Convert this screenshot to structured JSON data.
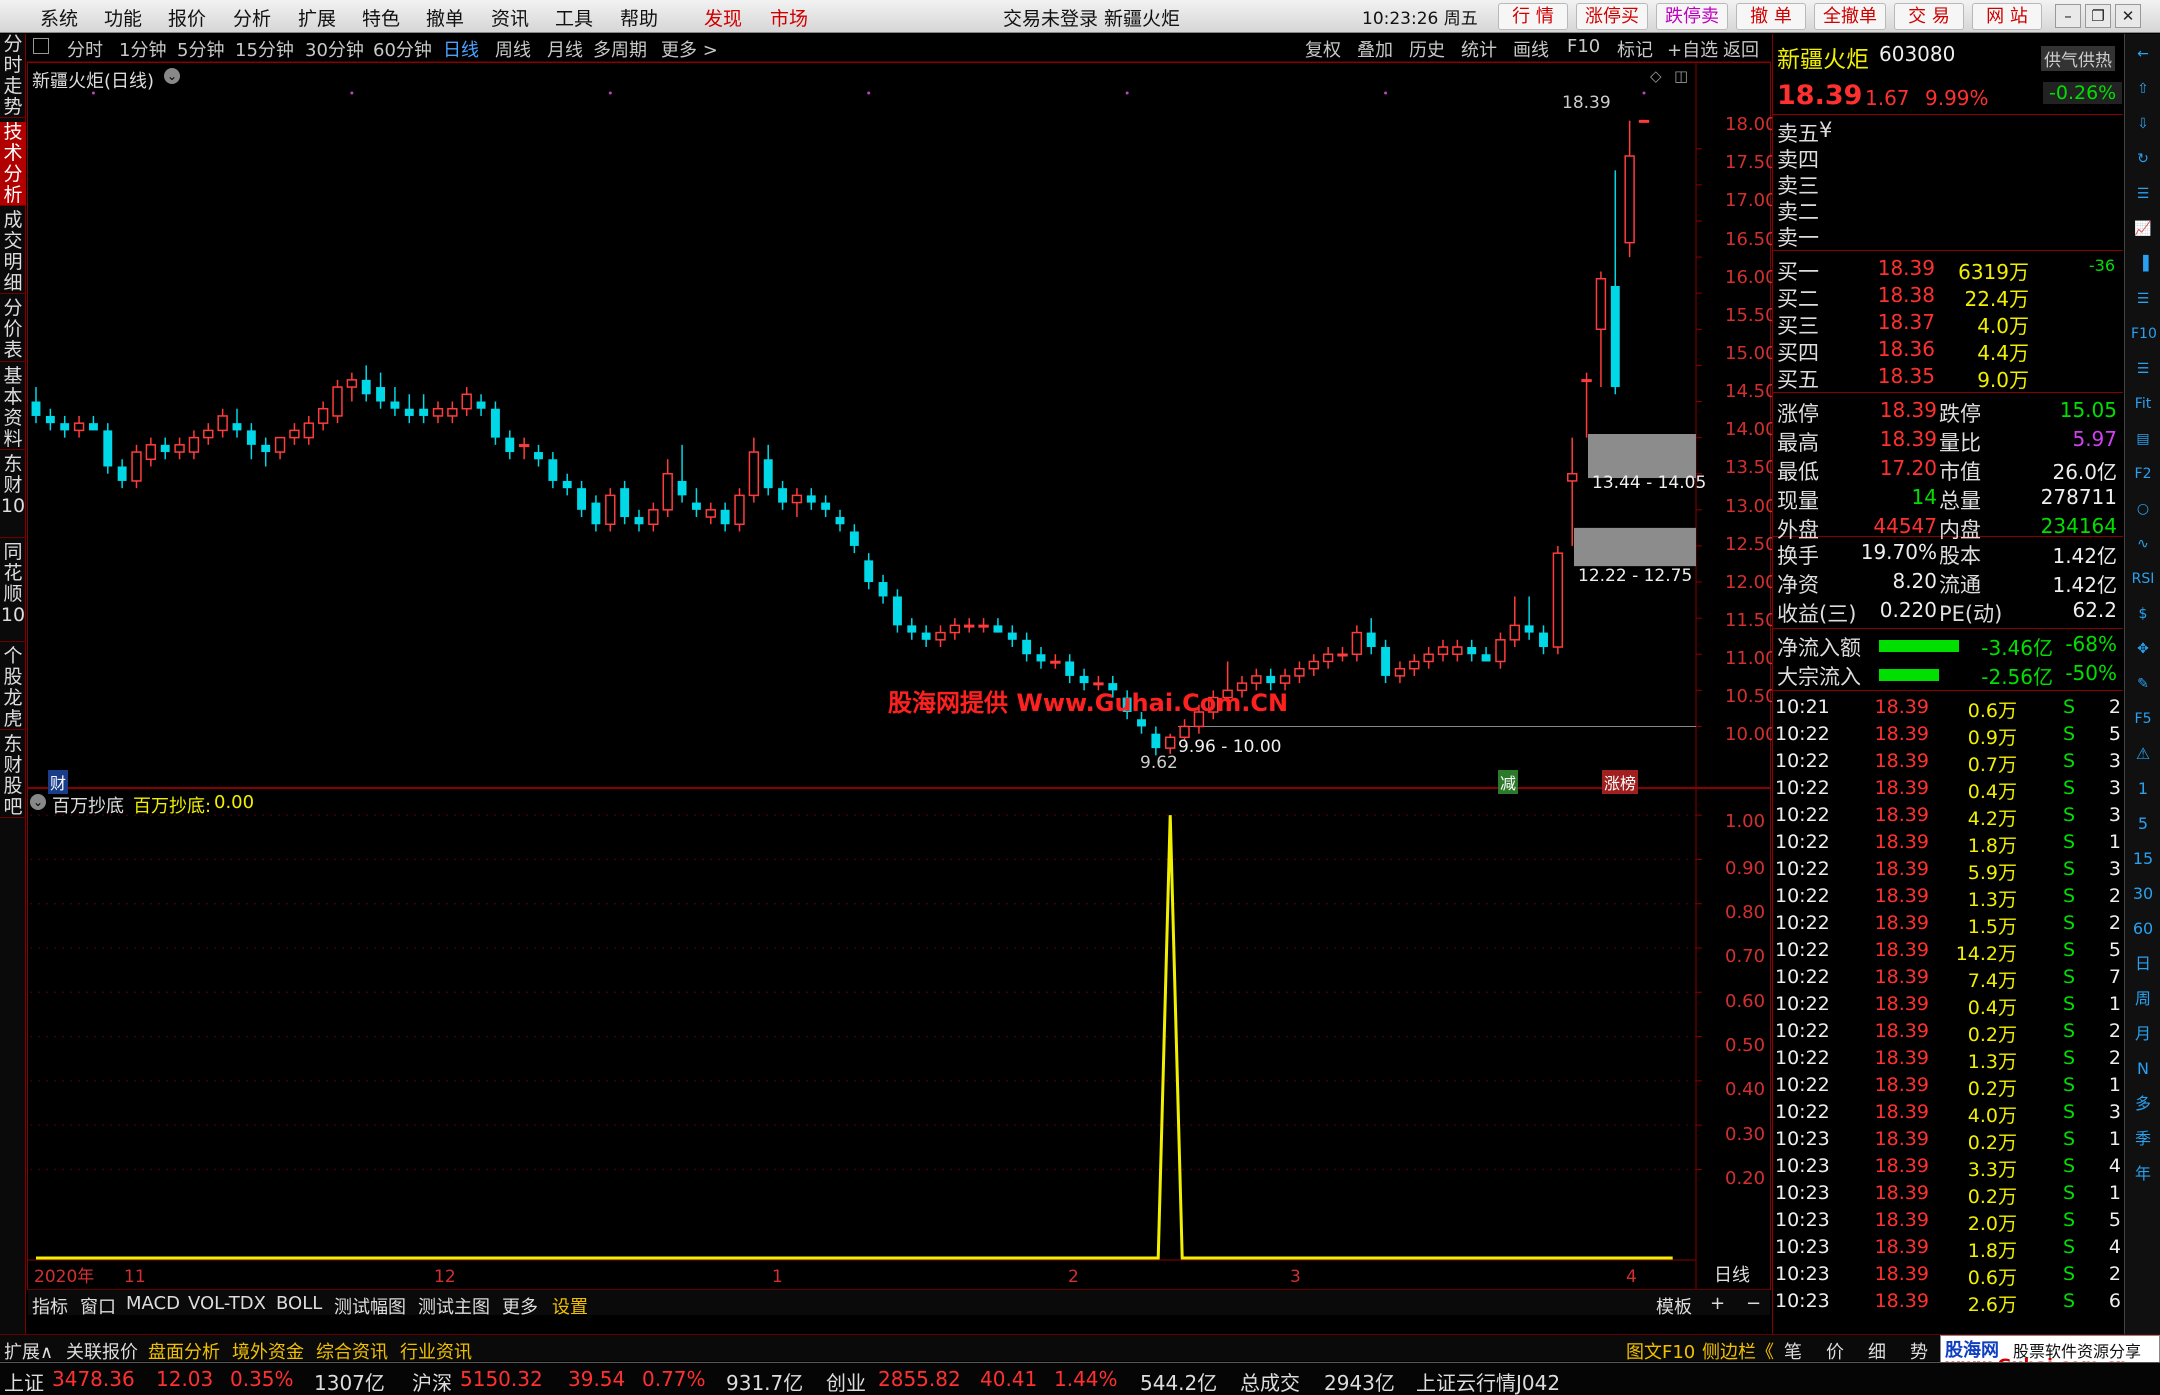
{
  "menu": {
    "items": [
      "系统",
      "功能",
      "报价",
      "分析",
      "扩展",
      "特色",
      "撤单",
      "资讯",
      "工具",
      "帮助"
    ],
    "faxian": "发现",
    "shichang": "市场",
    "title": "交易未登录  新疆火炬",
    "time": "10:23:26 周五",
    "right_buttons": [
      "行 情",
      "涨停买",
      "跌停卖",
      "撤 单",
      "全撤单",
      "交 易",
      "网 站"
    ]
  },
  "left_tabs": [
    "分时走势",
    "技术分析",
    "成交明细",
    "分价表",
    "基本资料",
    "东财10",
    "同花顺10",
    "个股龙虎",
    "东财股吧"
  ],
  "period_bar": {
    "items": [
      "分时",
      "1分钟",
      "5分钟",
      "15分钟",
      "30分钟",
      "60分钟",
      "日线",
      "周线",
      "月线",
      "多周期",
      "更多 >"
    ],
    "active": "日线",
    "right_items": [
      "复权",
      "叠加",
      "历史",
      "统计",
      "画线",
      "F10",
      "标记",
      "+自选",
      "返回"
    ]
  },
  "chart_data": [
    {
      "type": "candlestick",
      "title": "新疆火炬(日线)",
      "ylim": [
        9.3,
        18.8
      ],
      "y_ticks": [
        "18.00",
        "17.50",
        "17.00",
        "16.50",
        "16.00",
        "15.50",
        "15.00",
        "14.50",
        "14.00",
        "13.50",
        "13.00",
        "12.50",
        "12.00",
        "11.50",
        "11.00",
        "10.50",
        "10.00"
      ],
      "annotations": {
        "high": "18.39",
        "low": "9.62",
        "zone1": "13.44 - 14.05",
        "zone2": "12.22 - 12.75",
        "zone3": "9.96 - 10.00",
        "marker_left": "财",
        "marker_mid": "减",
        "marker_right": "涨榜",
        "watermark": "股海网提供 Www.Guhai.Com.CN"
      },
      "x_labels": [
        "2020年",
        "11",
        "12",
        "1",
        "2",
        "3",
        "4"
      ],
      "x_right": "日线",
      "candles": [
        [
          14.5,
          14.7,
          14.2,
          14.3
        ],
        [
          14.3,
          14.4,
          14.1,
          14.2
        ],
        [
          14.2,
          14.3,
          14.0,
          14.1
        ],
        [
          14.1,
          14.3,
          14.0,
          14.2
        ],
        [
          14.2,
          14.3,
          14.1,
          14.1
        ],
        [
          14.1,
          14.2,
          13.5,
          13.6
        ],
        [
          13.6,
          13.7,
          13.3,
          13.4
        ],
        [
          13.4,
          13.9,
          13.3,
          13.8
        ],
        [
          13.7,
          14.0,
          13.6,
          13.9
        ],
        [
          13.9,
          14.0,
          13.7,
          13.8
        ],
        [
          13.8,
          14.0,
          13.7,
          13.9
        ],
        [
          13.8,
          14.1,
          13.7,
          14.0
        ],
        [
          14.0,
          14.2,
          13.9,
          14.1
        ],
        [
          14.1,
          14.4,
          14.0,
          14.3
        ],
        [
          14.2,
          14.4,
          14.0,
          14.1
        ],
        [
          14.1,
          14.2,
          13.7,
          13.9
        ],
        [
          13.9,
          14.0,
          13.6,
          13.8
        ],
        [
          13.8,
          14.0,
          13.7,
          14.0
        ],
        [
          14.0,
          14.2,
          13.9,
          14.1
        ],
        [
          14.0,
          14.3,
          13.9,
          14.2
        ],
        [
          14.2,
          14.5,
          14.1,
          14.4
        ],
        [
          14.3,
          14.8,
          14.2,
          14.7
        ],
        [
          14.7,
          14.9,
          14.5,
          14.8
        ],
        [
          14.8,
          15.0,
          14.5,
          14.6
        ],
        [
          14.7,
          14.9,
          14.4,
          14.5
        ],
        [
          14.5,
          14.7,
          14.3,
          14.4
        ],
        [
          14.4,
          14.6,
          14.2,
          14.3
        ],
        [
          14.4,
          14.6,
          14.2,
          14.3
        ],
        [
          14.3,
          14.5,
          14.2,
          14.4
        ],
        [
          14.3,
          14.5,
          14.2,
          14.4
        ],
        [
          14.4,
          14.7,
          14.3,
          14.6
        ],
        [
          14.5,
          14.6,
          14.3,
          14.4
        ],
        [
          14.4,
          14.5,
          13.9,
          14.0
        ],
        [
          14.0,
          14.1,
          13.7,
          13.8
        ],
        [
          13.9,
          14.0,
          13.7,
          13.9
        ],
        [
          13.8,
          13.9,
          13.6,
          13.7
        ],
        [
          13.7,
          13.8,
          13.3,
          13.4
        ],
        [
          13.4,
          13.5,
          13.2,
          13.3
        ],
        [
          13.3,
          13.4,
          12.9,
          13.0
        ],
        [
          13.1,
          13.2,
          12.7,
          12.8
        ],
        [
          12.8,
          13.3,
          12.7,
          13.2
        ],
        [
          13.3,
          13.4,
          12.8,
          12.9
        ],
        [
          12.9,
          13.0,
          12.7,
          12.8
        ],
        [
          12.8,
          13.1,
          12.7,
          13.0
        ],
        [
          13.0,
          13.7,
          12.9,
          13.5
        ],
        [
          13.4,
          13.9,
          13.1,
          13.2
        ],
        [
          13.1,
          13.3,
          12.9,
          13.0
        ],
        [
          12.9,
          13.1,
          12.8,
          13.0
        ],
        [
          13.0,
          13.1,
          12.7,
          12.8
        ],
        [
          12.8,
          13.3,
          12.7,
          13.2
        ],
        [
          13.2,
          14.0,
          13.1,
          13.8
        ],
        [
          13.7,
          13.9,
          13.2,
          13.3
        ],
        [
          13.3,
          13.4,
          13.0,
          13.1
        ],
        [
          13.1,
          13.3,
          12.9,
          13.2
        ],
        [
          13.2,
          13.3,
          13.0,
          13.1
        ],
        [
          13.1,
          13.2,
          12.9,
          13.0
        ],
        [
          12.9,
          13.0,
          12.7,
          12.8
        ],
        [
          12.7,
          12.8,
          12.4,
          12.5
        ],
        [
          12.3,
          12.4,
          11.9,
          12.0
        ],
        [
          12.0,
          12.1,
          11.7,
          11.8
        ],
        [
          11.8,
          11.9,
          11.3,
          11.4
        ],
        [
          11.4,
          11.5,
          11.2,
          11.3
        ],
        [
          11.3,
          11.4,
          11.1,
          11.2
        ],
        [
          11.2,
          11.4,
          11.1,
          11.3
        ],
        [
          11.3,
          11.5,
          11.2,
          11.4
        ],
        [
          11.4,
          11.5,
          11.3,
          11.4
        ],
        [
          11.4,
          11.5,
          11.3,
          11.4
        ],
        [
          11.4,
          11.5,
          11.3,
          11.3
        ],
        [
          11.3,
          11.4,
          11.1,
          11.2
        ],
        [
          11.2,
          11.3,
          10.9,
          11.0
        ],
        [
          11.0,
          11.1,
          10.8,
          10.9
        ],
        [
          10.9,
          11.0,
          10.8,
          10.9
        ],
        [
          10.9,
          11.0,
          10.6,
          10.7
        ],
        [
          10.7,
          10.8,
          10.5,
          10.6
        ],
        [
          10.6,
          10.7,
          10.5,
          10.6
        ],
        [
          10.6,
          10.7,
          10.4,
          10.5
        ],
        [
          10.4,
          10.5,
          10.1,
          10.2
        ],
        [
          10.1,
          10.2,
          9.9,
          10.0
        ],
        [
          9.9,
          10.0,
          9.6,
          9.7
        ],
        [
          9.7,
          9.9,
          9.62,
          9.85
        ],
        [
          9.85,
          10.1,
          9.8,
          10.0
        ],
        [
          10.0,
          10.3,
          9.9,
          10.2
        ],
        [
          10.2,
          10.5,
          10.1,
          10.4
        ],
        [
          10.4,
          10.9,
          10.3,
          10.5
        ],
        [
          10.5,
          10.7,
          10.4,
          10.6
        ],
        [
          10.6,
          10.8,
          10.5,
          10.7
        ],
        [
          10.7,
          10.8,
          10.5,
          10.6
        ],
        [
          10.6,
          10.8,
          10.5,
          10.7
        ],
        [
          10.7,
          10.9,
          10.6,
          10.8
        ],
        [
          10.8,
          11.0,
          10.7,
          10.9
        ],
        [
          10.9,
          11.1,
          10.8,
          11.0
        ],
        [
          11.0,
          11.1,
          10.9,
          11.0
        ],
        [
          11.0,
          11.4,
          10.9,
          11.3
        ],
        [
          11.3,
          11.5,
          11.0,
          11.1
        ],
        [
          11.1,
          11.2,
          10.6,
          10.7
        ],
        [
          10.7,
          10.9,
          10.6,
          10.8
        ],
        [
          10.8,
          11.0,
          10.7,
          10.9
        ],
        [
          10.9,
          11.1,
          10.8,
          11.0
        ],
        [
          11.0,
          11.2,
          10.9,
          11.1
        ],
        [
          11.0,
          11.2,
          10.9,
          11.1
        ],
        [
          11.1,
          11.2,
          10.9,
          11.0
        ],
        [
          11.0,
          11.1,
          10.9,
          10.9
        ],
        [
          10.9,
          11.3,
          10.8,
          11.2
        ],
        [
          11.2,
          11.8,
          11.1,
          11.4
        ],
        [
          11.4,
          11.8,
          11.2,
          11.3
        ],
        [
          11.3,
          11.4,
          11.0,
          11.1
        ],
        [
          11.1,
          12.5,
          11.0,
          12.4
        ],
        [
          13.4,
          14.0,
          12.5,
          13.5
        ],
        [
          14.8,
          14.9,
          14.0,
          14.8
        ],
        [
          15.5,
          16.3,
          14.7,
          16.2
        ],
        [
          16.1,
          17.7,
          14.6,
          14.7
        ],
        [
          16.7,
          18.39,
          16.5,
          17.9
        ],
        [
          18.39,
          18.39,
          18.39,
          18.39
        ]
      ]
    },
    {
      "type": "line",
      "name": "百万抄底",
      "label": "百万抄底:",
      "value_text": "0.00",
      "ylim": [
        0,
        1.05
      ],
      "y_ticks": [
        "1.00",
        "0.90",
        "0.80",
        "0.70",
        "0.60",
        "0.50",
        "0.40",
        "0.30",
        "0.20"
      ],
      "spike_index": 79,
      "length": 115
    }
  ],
  "indicator_tabs": {
    "items": [
      "指标",
      "窗口",
      "MACD",
      "VOL-TDX",
      "BOLL",
      "测试幅图",
      "测试主图",
      "更多",
      "设置"
    ],
    "right": [
      "模板",
      "+",
      "−"
    ]
  },
  "quote": {
    "name": "新疆火炬",
    "code": "603080",
    "price": "18.39",
    "change": "1.67",
    "pct": "9.99%",
    "tag": "供气供热",
    "tag_pct": "-0.26%",
    "asks": [
      {
        "l": "卖五",
        "p": "¥",
        "v": ""
      },
      {
        "l": "卖四",
        "p": "",
        "v": ""
      },
      {
        "l": "卖三",
        "p": "",
        "v": ""
      },
      {
        "l": "卖二",
        "p": "",
        "v": ""
      },
      {
        "l": "卖一",
        "p": "",
        "v": ""
      }
    ],
    "bids": [
      {
        "l": "买一",
        "p": "18.39",
        "v": "6319万",
        "c": "-36"
      },
      {
        "l": "买二",
        "p": "18.38",
        "v": "22.4万",
        "c": ""
      },
      {
        "l": "买三",
        "p": "18.37",
        "v": "4.0万",
        "c": ""
      },
      {
        "l": "买四",
        "p": "18.36",
        "v": "4.4万",
        "c": ""
      },
      {
        "l": "买五",
        "p": "18.35",
        "v": "9.0万",
        "c": ""
      }
    ],
    "stats": [
      {
        "a": "涨停",
        "av": "18.39",
        "ac": "red",
        "b": "跌停",
        "bv": "15.05",
        "bc": "grn"
      },
      {
        "a": "最高",
        "av": "18.39",
        "ac": "red",
        "b": "量比",
        "bv": "5.97",
        "bc": "mag"
      },
      {
        "a": "最低",
        "av": "17.20",
        "ac": "red",
        "b": "市值",
        "bv": "26.0亿",
        "bc": "wht"
      },
      {
        "a": "现量",
        "av": "14",
        "ac": "grn",
        "b": "总量",
        "bv": "278711",
        "bc": "wht"
      },
      {
        "a": "外盘",
        "av": "44547",
        "ac": "red",
        "b": "内盘",
        "bv": "234164",
        "bc": "grn"
      }
    ],
    "stats2": [
      {
        "a": "换手",
        "av": "19.70%",
        "b": "股本",
        "bv": "1.42亿"
      },
      {
        "a": "净资",
        "av": "8.20",
        "b": "流通",
        "bv": "1.42亿"
      },
      {
        "a": "收益(三)",
        "av": "0.220",
        "b": "PE(动)",
        "bv": "62.2"
      }
    ],
    "flows": [
      {
        "l": "净流入额",
        "v": "-3.46亿",
        "p": "-68%"
      },
      {
        "l": "大宗流入",
        "v": "-2.56亿",
        "p": "-50%"
      }
    ]
  },
  "ticks": [
    [
      "10:21",
      "18.39",
      "0.6万",
      "2"
    ],
    [
      "10:22",
      "18.39",
      "0.9万",
      "5"
    ],
    [
      "10:22",
      "18.39",
      "0.7万",
      "3"
    ],
    [
      "10:22",
      "18.39",
      "0.4万",
      "3"
    ],
    [
      "10:22",
      "18.39",
      "4.2万",
      "3"
    ],
    [
      "10:22",
      "18.39",
      "1.8万",
      "1"
    ],
    [
      "10:22",
      "18.39",
      "5.9万",
      "3"
    ],
    [
      "10:22",
      "18.39",
      "1.3万",
      "2"
    ],
    [
      "10:22",
      "18.39",
      "1.5万",
      "2"
    ],
    [
      "10:22",
      "18.39",
      "14.2万",
      "5"
    ],
    [
      "10:22",
      "18.39",
      "7.4万",
      "7"
    ],
    [
      "10:22",
      "18.39",
      "0.4万",
      "1"
    ],
    [
      "10:22",
      "18.39",
      "0.2万",
      "2"
    ],
    [
      "10:22",
      "18.39",
      "1.3万",
      "2"
    ],
    [
      "10:22",
      "18.39",
      "0.2万",
      "1"
    ],
    [
      "10:22",
      "18.39",
      "4.0万",
      "3"
    ],
    [
      "10:23",
      "18.39",
      "0.2万",
      "1"
    ],
    [
      "10:23",
      "18.39",
      "3.3万",
      "4"
    ],
    [
      "10:23",
      "18.39",
      "0.2万",
      "1"
    ],
    [
      "10:23",
      "18.39",
      "2.0万",
      "5"
    ],
    [
      "10:23",
      "18.39",
      "1.8万",
      "4"
    ],
    [
      "10:23",
      "18.39",
      "0.6万",
      "2"
    ],
    [
      "10:23",
      "18.39",
      "2.6万",
      "6"
    ]
  ],
  "tick_side": "S",
  "bottom_tabs": [
    "扩展∧",
    "关联报价",
    "盘面分析",
    "境外资金",
    "综合资讯",
    "行业资讯"
  ],
  "bottom_right": [
    "图文F10",
    "侧边栏《"
  ],
  "bottom_tabs2": [
    "笔",
    "价",
    "细",
    "势"
  ],
  "brand": {
    "name": "股海网",
    "slogan": "股票软件资源分享",
    "url": "www.Guhai.com.cn"
  },
  "status": {
    "sh": "上证",
    "sh_val": "3478.36",
    "sh_chg": "12.03",
    "sh_pct": "0.35%",
    "sh_amt": "1307亿",
    "hs": "沪深",
    "hs_val": "5150.32",
    "hs_chg": "39.54",
    "hs_pct": "0.77%",
    "hs_amt": "931.7亿",
    "cy": "创业",
    "cy_val": "2855.82",
    "cy_chg": "40.41",
    "cy_pct": "1.44%",
    "cy_amt": "544.2亿",
    "total": "总成交",
    "total_amt": "2943亿",
    "cloud": "上证云行情J042"
  },
  "side_icons": [
    "←",
    "⇧",
    "⇩",
    "↻",
    "☰",
    "📈",
    "▐",
    "☰",
    "F10",
    "☰",
    "Fit",
    "▤",
    "F2",
    "○",
    "∿",
    "RSI",
    "$",
    "✥",
    "✎",
    "F5",
    "⚠",
    "1",
    "5",
    "15",
    "30",
    "60",
    "日",
    "周",
    "月",
    "N",
    "多",
    "季",
    "年"
  ]
}
